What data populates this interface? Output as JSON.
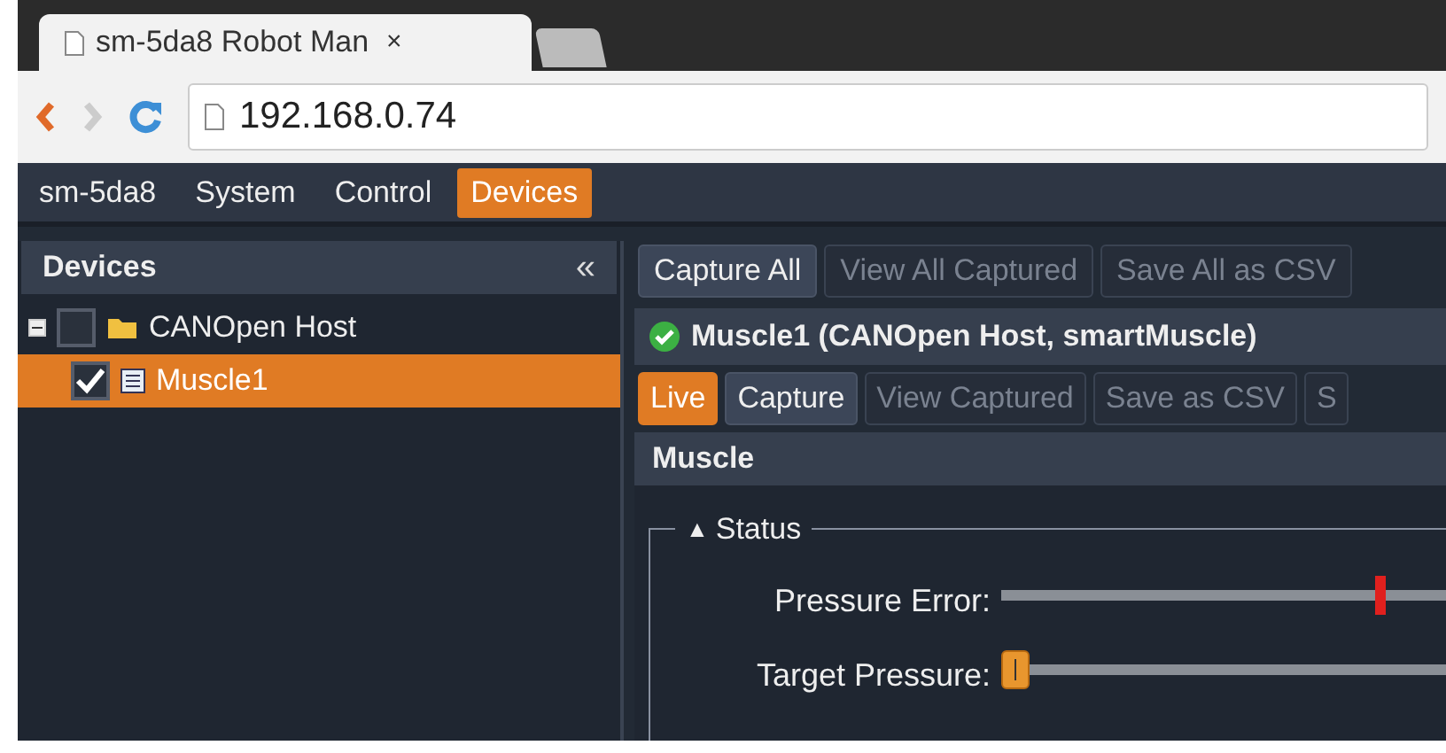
{
  "browser": {
    "tab_title": "sm-5da8 Robot Man",
    "tab_close": "×",
    "url": "192.168.0.74"
  },
  "menu": [
    {
      "label": "sm-5da8",
      "selected": false
    },
    {
      "label": "System",
      "selected": false
    },
    {
      "label": "Control",
      "selected": false
    },
    {
      "label": "Devices",
      "selected": true
    }
  ],
  "sidebar": {
    "title": "Devices",
    "collapse": "«",
    "tree": [
      {
        "label": "CANOpen Host",
        "kind": "folder",
        "checked": false,
        "selected": false,
        "expanded": true,
        "children": [
          {
            "label": "Muscle1",
            "kind": "device",
            "checked": true,
            "selected": true
          }
        ]
      }
    ]
  },
  "toolbar": [
    {
      "label": "Capture All",
      "disabled": false
    },
    {
      "label": "View All Captured",
      "disabled": true
    },
    {
      "label": "Save All as CSV",
      "disabled": true
    }
  ],
  "device": {
    "title": "Muscle1 (CANOpen Host, smartMuscle)",
    "ok": true,
    "tabs": [
      {
        "label": "Live",
        "selected": true,
        "disabled": false
      },
      {
        "label": "Capture",
        "selected": false,
        "disabled": false
      },
      {
        "label": "View Captured",
        "selected": false,
        "disabled": true
      },
      {
        "label": "Save as CSV",
        "selected": false,
        "disabled": true
      },
      {
        "label": "S",
        "selected": false,
        "disabled": true
      }
    ],
    "section": "Muscle",
    "group": {
      "toggle": "▲",
      "title": "Status",
      "expanded": true,
      "rows": [
        {
          "label": "Pressure Error:",
          "kind": "marker",
          "level": 0.86
        },
        {
          "label": "Target Pressure:",
          "kind": "slider",
          "level": 0
        }
      ]
    }
  }
}
